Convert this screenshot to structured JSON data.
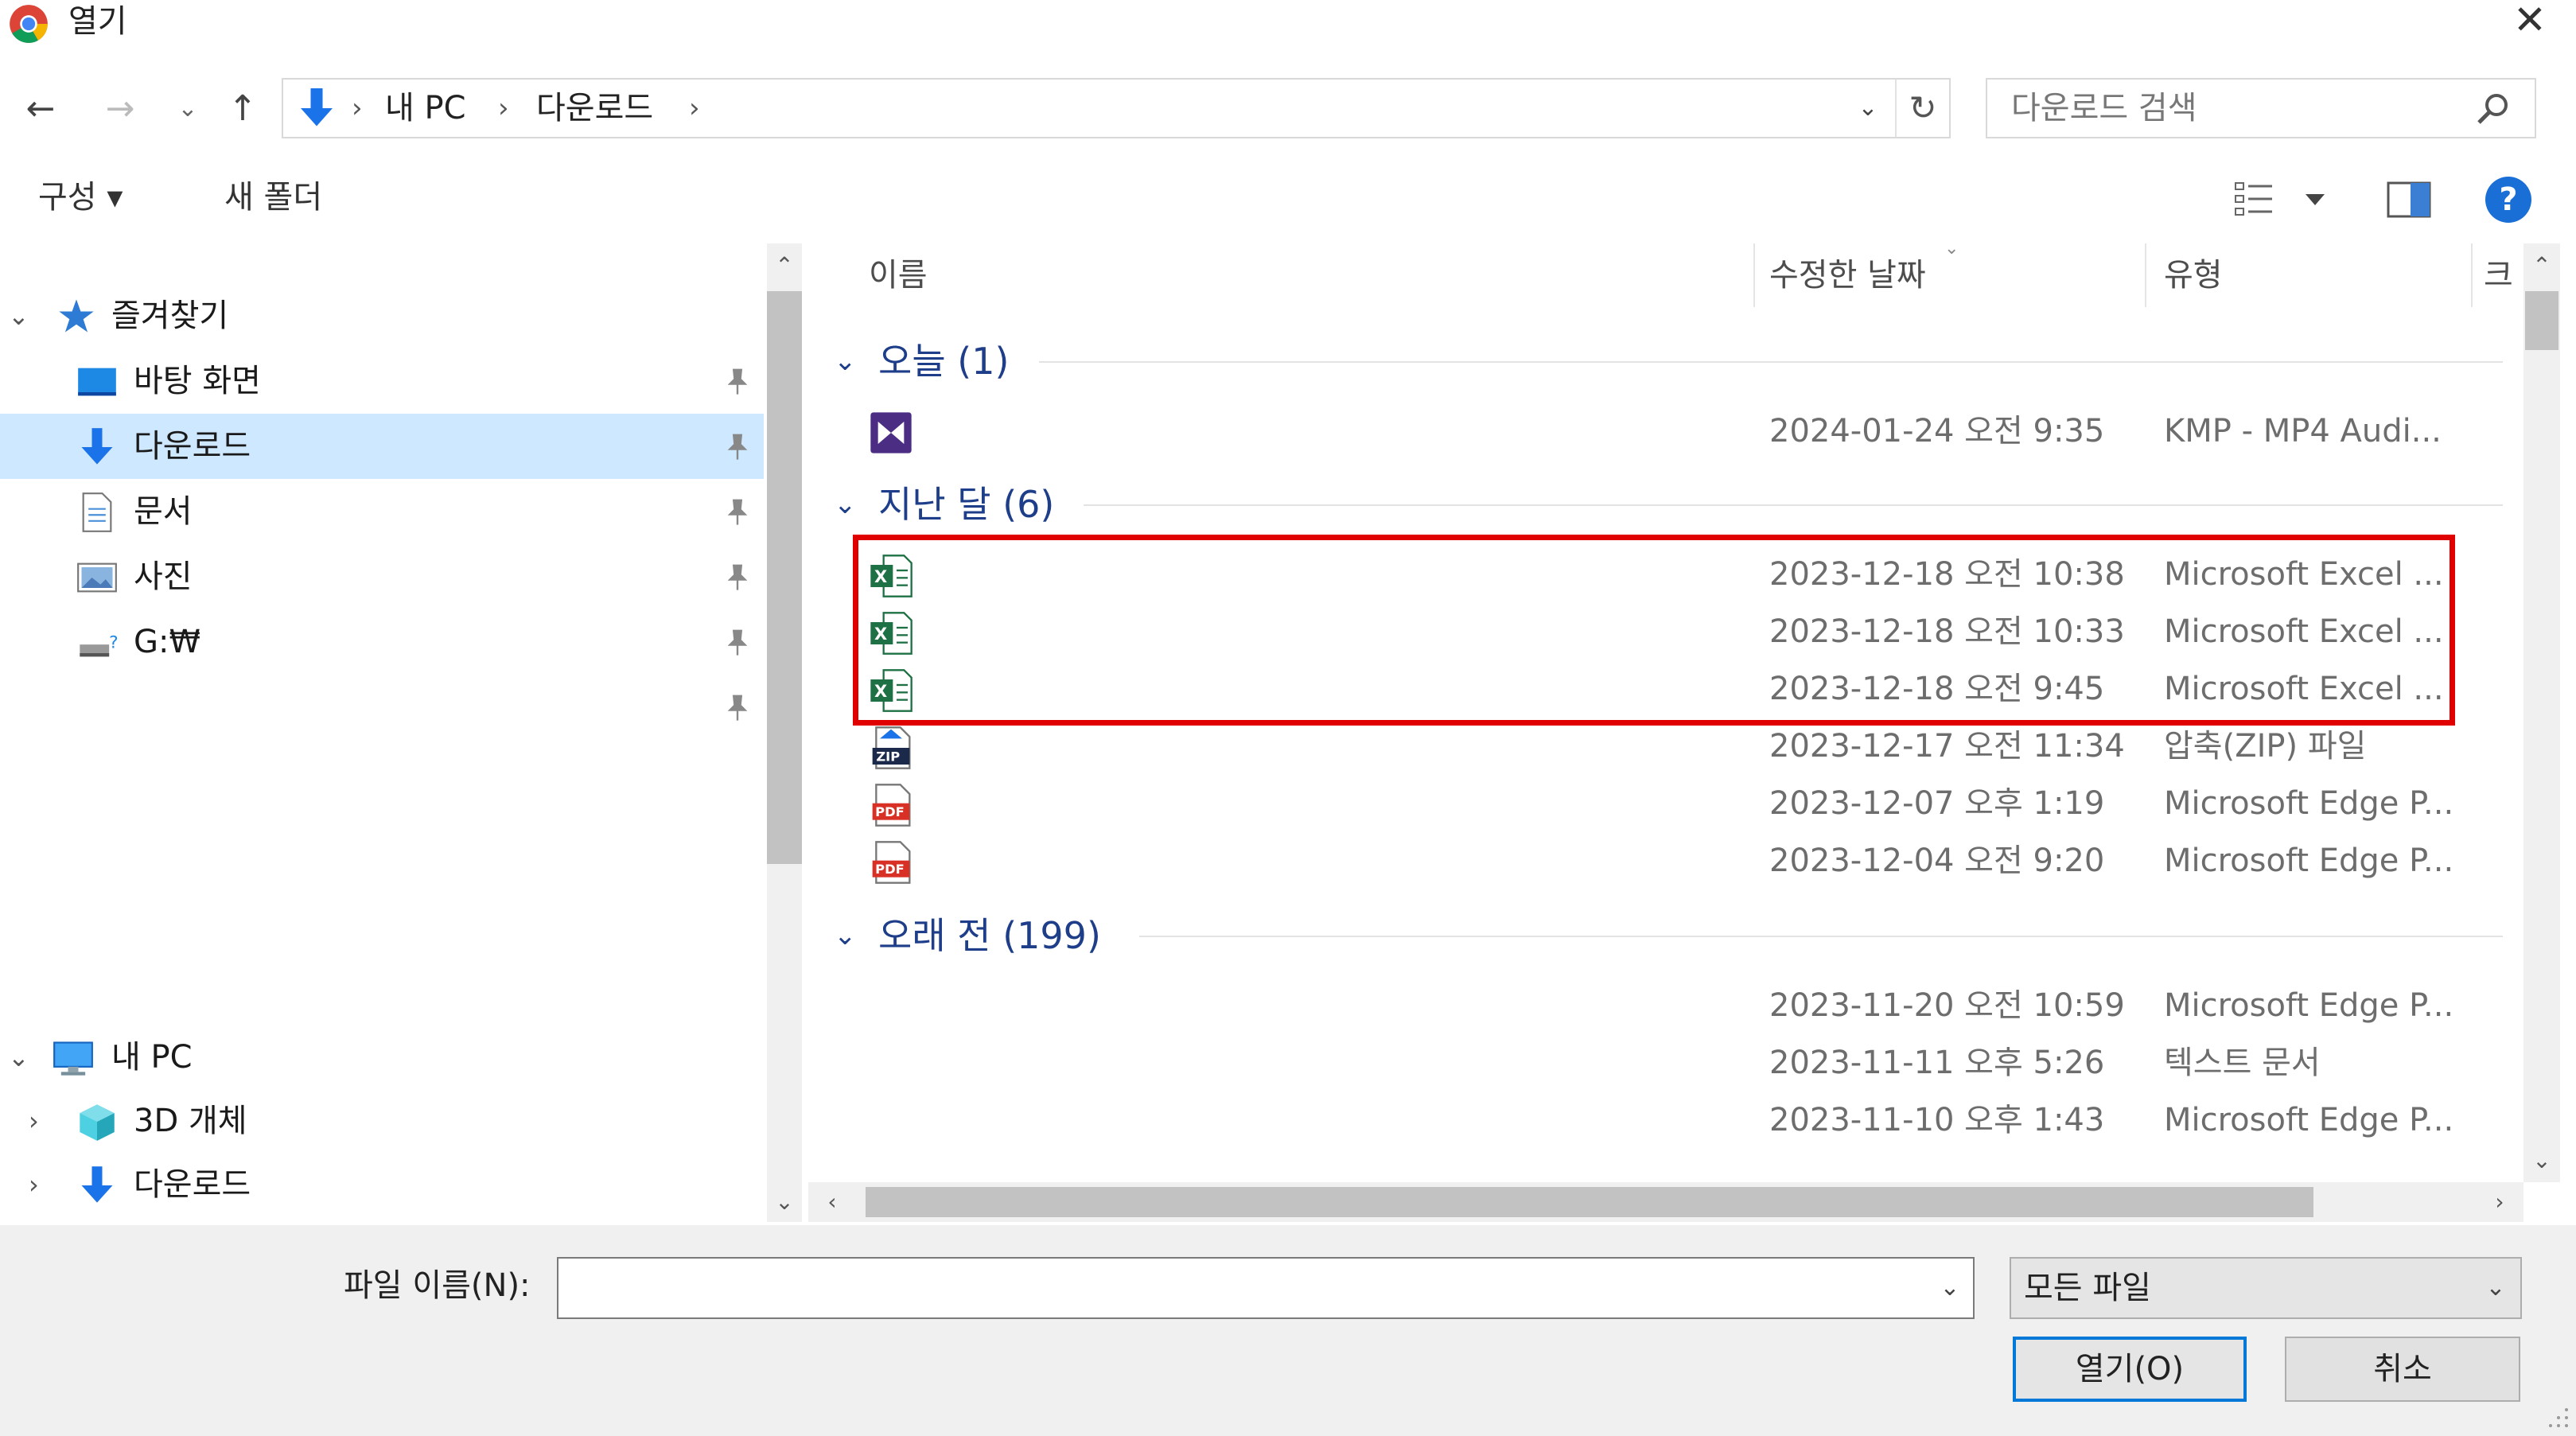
{
  "window": {
    "title": "열기",
    "close_glyph": "✕"
  },
  "nav": {
    "back": "←",
    "forward": "→",
    "recent": "⌄",
    "up": "↑",
    "breadcrumbs": [
      "내 PC",
      "다운로드"
    ],
    "separator": "›",
    "dropdown": "⌄",
    "refresh": "↻",
    "search_placeholder": "다운로드 검색"
  },
  "toolbar": {
    "organize": "구성 ▾",
    "new_folder": "새 폴더",
    "help": "?"
  },
  "sidebar": {
    "quick_access": "즐겨찾기",
    "items": [
      {
        "label": "바탕 화면",
        "icon": "desktop-icon"
      },
      {
        "label": "다운로드",
        "icon": "download-icon",
        "selected": true
      },
      {
        "label": "문서",
        "icon": "document-icon"
      },
      {
        "label": "사진",
        "icon": "pictures-icon"
      },
      {
        "label": "G:₩",
        "icon": "drive-icon"
      }
    ],
    "this_pc": "내 PC",
    "pc_items": [
      {
        "label": "3D 개체",
        "icon": "3d-objects-icon"
      },
      {
        "label": "다운로드",
        "icon": "download-icon"
      }
    ]
  },
  "columns": {
    "name": "이름",
    "modified": "수정한 날짜",
    "type": "유형",
    "size": "크"
  },
  "groups": [
    {
      "label": "오늘 (1)",
      "rows": [
        {
          "icon": "kmp-video-icon",
          "date": "2024-01-24 오전 9:35",
          "type": "KMP - MP4 Audi..."
        }
      ]
    },
    {
      "label": "지난 달 (6)",
      "rows": [
        {
          "icon": "excel-icon",
          "date": "2023-12-18 오전 10:38",
          "type": "Microsoft Excel ..."
        },
        {
          "icon": "excel-icon",
          "date": "2023-12-18 오전 10:33",
          "type": "Microsoft Excel ..."
        },
        {
          "icon": "excel-icon",
          "date": "2023-12-18 오전 9:45",
          "type": "Microsoft Excel ..."
        },
        {
          "icon": "zip-icon",
          "date": "2023-12-17 오전 11:34",
          "type": "압축(ZIP) 파일"
        },
        {
          "icon": "pdf-icon",
          "date": "2023-12-07 오후 1:19",
          "type": "Microsoft Edge P..."
        },
        {
          "icon": "pdf-icon",
          "date": "2023-12-04 오전 9:20",
          "type": "Microsoft Edge P..."
        }
      ]
    },
    {
      "label": "오래 전 (199)",
      "rows": [
        {
          "icon": "",
          "date": "2023-11-20 오전 10:59",
          "type": "Microsoft Edge P..."
        },
        {
          "icon": "",
          "date": "2023-11-11 오후 5:26",
          "type": "텍스트 문서"
        },
        {
          "icon": "",
          "date": "2023-11-10 오후 1:43",
          "type": "Microsoft Edge P..."
        }
      ]
    }
  ],
  "bottom": {
    "filename_label": "파일 이름(N):",
    "filename_value": "",
    "filetype": "모든 파일",
    "open": "열기(O)",
    "cancel": "취소"
  },
  "colors": {
    "accent": "#0078d7",
    "selection": "#cde8ff",
    "group_text": "#1e3e8a",
    "highlight": "#e00000"
  }
}
